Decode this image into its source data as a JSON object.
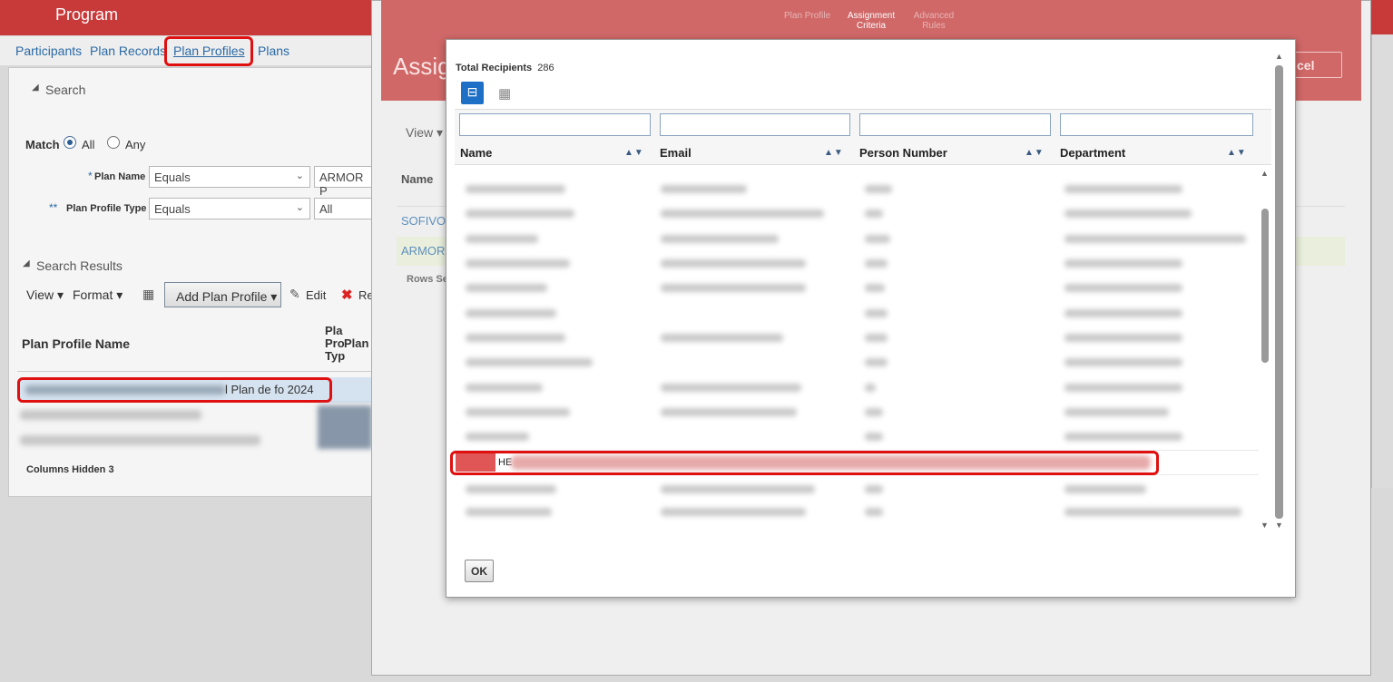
{
  "app": {
    "title": "Program"
  },
  "tabs": [
    "Participants",
    "Plan Records",
    "Plan Profiles",
    "Plans"
  ],
  "search": {
    "header": "Search",
    "match_label": "Match",
    "match_all": "All",
    "match_any": "Any",
    "plan_name_req": "*",
    "plan_name_label": "Plan Name",
    "plan_name_op": "Equals",
    "plan_name_value": "ARMOR P",
    "profile_type_req": "**",
    "profile_type_label": "Plan Profile Type",
    "profile_type_op": "Equals",
    "profile_type_value": "All"
  },
  "results": {
    "header": "Search Results",
    "view": "View",
    "format": "Format",
    "add_button": "Add Plan Profile",
    "edit": "Edit",
    "remove": "Re",
    "col_name": "Plan Profile Name",
    "col_type_1": "Pla",
    "col_type_2": "Pro",
    "col_type_3": "Typ",
    "col_plan": "Plan",
    "row1_text": "l Plan de fo 2024",
    "columns_hidden_label": "Columns Hidden",
    "columns_hidden_count": "3"
  },
  "underlying": {
    "train": [
      "Plan Profile",
      "Assignment Criteria",
      "Advanced Rules"
    ],
    "title": "Assig",
    "cancel": "cel",
    "view": "View",
    "col_name": "Name",
    "row1": "SOFIVO",
    "row2": "ARMOR",
    "rows_sel": "Rows Se"
  },
  "modal": {
    "total_label": "Total Recipients",
    "total_count": "286",
    "columns": [
      "Name",
      "Email",
      "Person Number",
      "Department"
    ],
    "highlight_text": "HE",
    "ok": "OK"
  },
  "colors": {
    "brand_red": "#c8393a",
    "link_blue": "#2b6aa5",
    "highlight": "#e01010"
  }
}
